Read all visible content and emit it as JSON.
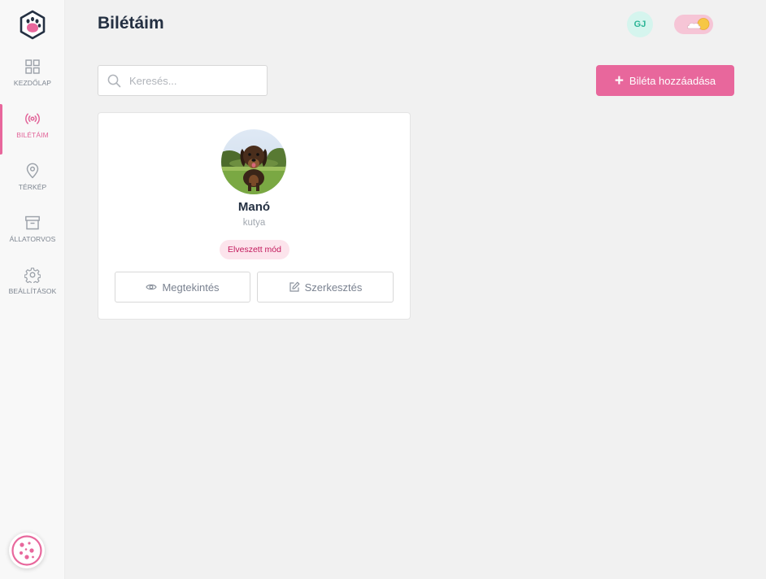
{
  "header": {
    "title": "Bilétáim",
    "avatar_initials": "GJ"
  },
  "sidebar": {
    "items": [
      {
        "label": "KEZDŐLAP",
        "icon": "grid-icon"
      },
      {
        "label": "BILÉTÁIM",
        "icon": "broadcast-icon",
        "active": true
      },
      {
        "label": "TÉRKÉP",
        "icon": "map-pin-icon"
      },
      {
        "label": "ÁLLATORVOS",
        "icon": "archive-icon"
      },
      {
        "label": "BEÁLLÍTÁSOK",
        "icon": "gear-icon"
      }
    ]
  },
  "toolbar": {
    "search_placeholder": "Keresés...",
    "add_label": "Biléta hozzáadása"
  },
  "pets": [
    {
      "name": "Manó",
      "type": "kutya",
      "badge": "Elveszett mód",
      "view_label": "Megtekintés",
      "edit_label": "Szerkesztés"
    }
  ],
  "colors": {
    "accent": "#e8679c",
    "badge_bg": "#fce4ec",
    "badge_text": "#c2185b",
    "avatar_bg": "#d5f5ee",
    "avatar_text": "#2bb596"
  }
}
